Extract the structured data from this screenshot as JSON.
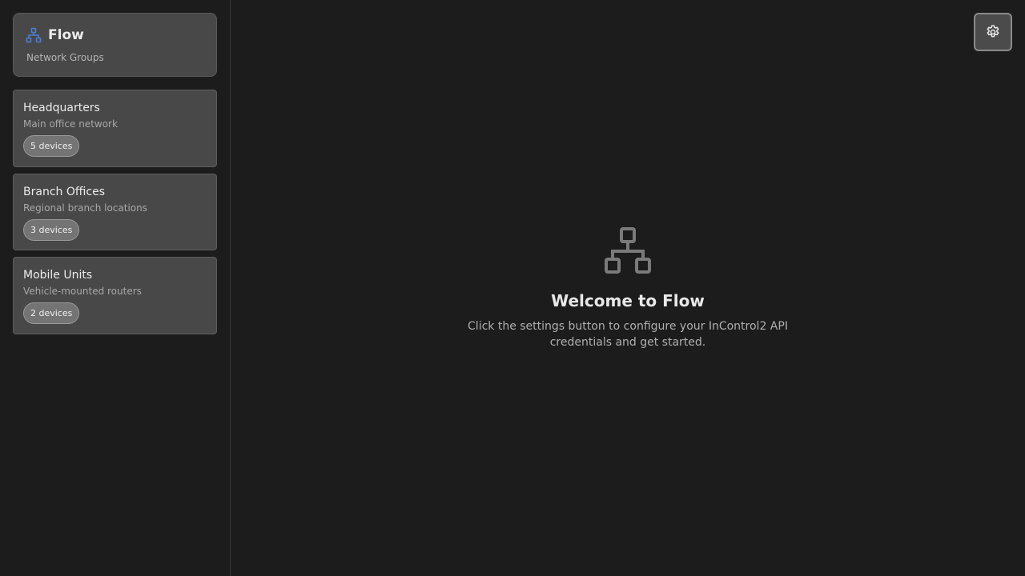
{
  "brand": {
    "title": "Flow",
    "subtitle": "Network Groups",
    "icon": "network-icon",
    "accent_color": "#4a7fd4"
  },
  "groups": [
    {
      "name": "Headquarters",
      "description": "Main office network",
      "badge": "5 devices"
    },
    {
      "name": "Branch Offices",
      "description": "Regional branch locations",
      "badge": "3 devices"
    },
    {
      "name": "Mobile Units",
      "description": "Vehicle-mounted routers",
      "badge": "2 devices"
    }
  ],
  "settings": {
    "icon": "gear-icon"
  },
  "welcome": {
    "icon": "network-icon",
    "title": "Welcome to Flow",
    "text": "Click the settings button to configure your InControl2 API credentials and get started."
  }
}
